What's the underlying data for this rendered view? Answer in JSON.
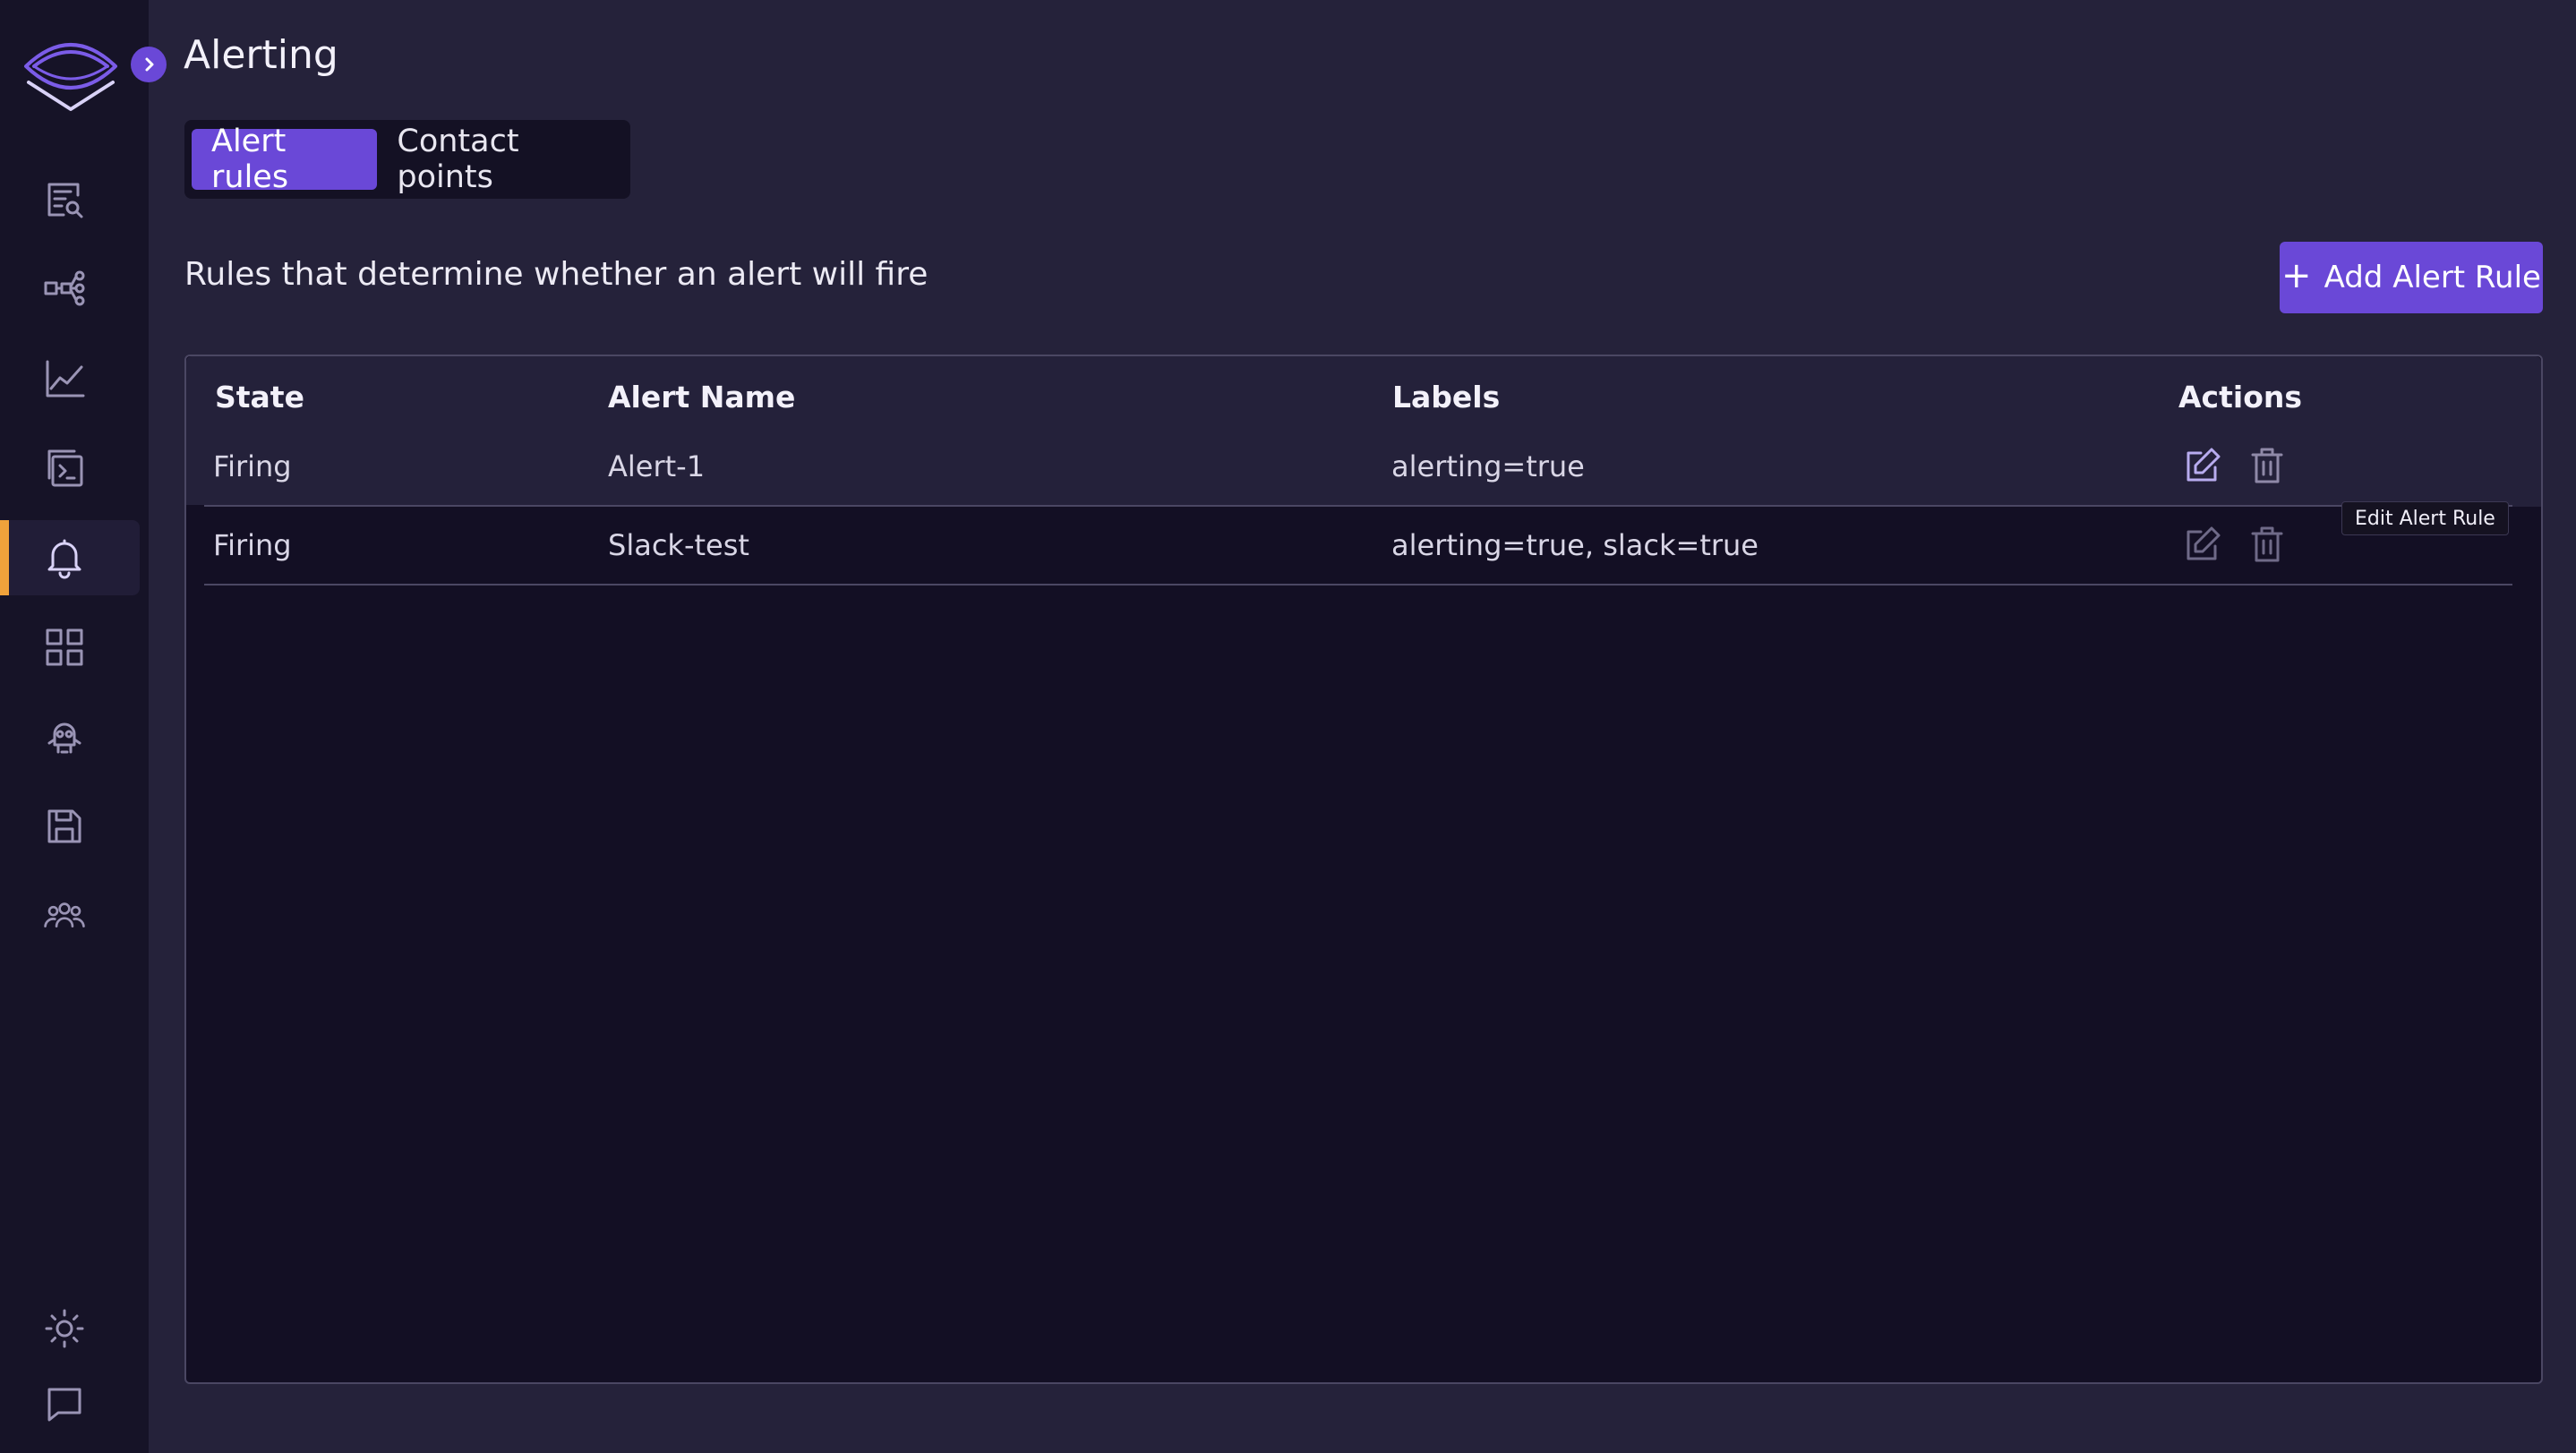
{
  "page": {
    "title": "Alerting",
    "subtitle": "Rules that determine whether an alert will fire"
  },
  "tabs": [
    {
      "label": "Alert rules",
      "active": true
    },
    {
      "label": "Contact points",
      "active": false
    }
  ],
  "add_button": {
    "label": "Add Alert Rule",
    "icon": "plus-icon"
  },
  "table": {
    "columns": [
      "State",
      "Alert Name",
      "Labels",
      "Actions"
    ],
    "rows": [
      {
        "state": "Firing",
        "name": "Alert-1",
        "labels": "alerting=true"
      },
      {
        "state": "Firing",
        "name": "Slack-test",
        "labels": "alerting=true, slack=true"
      }
    ]
  },
  "tooltip": "Edit Alert Rule",
  "sidebar": {
    "items": [
      {
        "icon": "logs-search-icon"
      },
      {
        "icon": "service-map-icon"
      },
      {
        "icon": "metrics-chart-icon"
      },
      {
        "icon": "query-terminal-icon"
      },
      {
        "icon": "bell-icon",
        "active": true
      },
      {
        "icon": "dashboards-grid-icon"
      },
      {
        "icon": "bot-icon"
      },
      {
        "icon": "save-icon"
      },
      {
        "icon": "users-icon"
      }
    ],
    "bottom": [
      {
        "icon": "theme-sun-icon"
      },
      {
        "icon": "feedback-chat-icon"
      }
    ]
  },
  "colors": {
    "accent": "#6a48d7",
    "active_indicator": "#f0a23b",
    "sidebar_bg": "#161327",
    "page_bg": "#25223a",
    "panel_bg": "#130f24"
  }
}
